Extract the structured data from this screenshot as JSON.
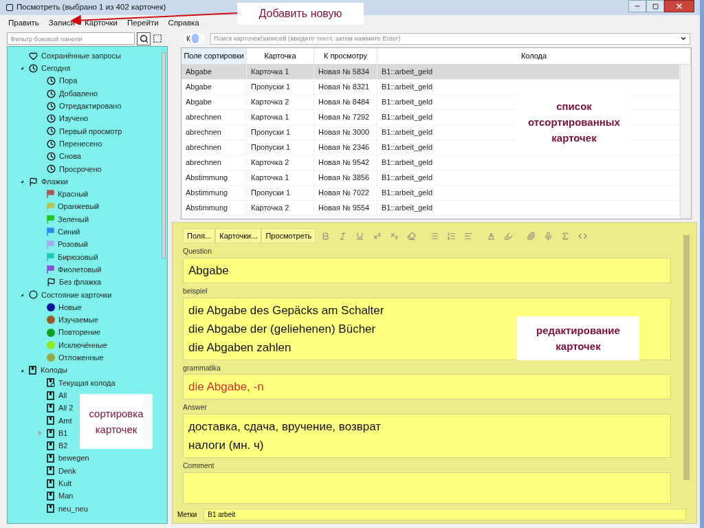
{
  "window": {
    "title": "Посмотреть (выбрано 1 из 402 карточек)"
  },
  "menu": [
    "Править",
    "Записи",
    "Карточки",
    "Перейти",
    "Справка"
  ],
  "sidebar": {
    "filter_placeholder": "Фильтр боковой панели",
    "items": [
      {
        "kind": "saved",
        "label": "Сохранённые запросы"
      },
      {
        "kind": "clock",
        "label": "Сегодня",
        "expanded": true,
        "children": [
          {
            "kind": "clock",
            "label": "Пора"
          },
          {
            "kind": "clock",
            "label": "Добавлено"
          },
          {
            "kind": "clock",
            "label": "Отредактировано"
          },
          {
            "kind": "clock",
            "label": "Изучено"
          },
          {
            "kind": "clock",
            "label": "Первый просмотр"
          },
          {
            "kind": "clock",
            "label": "Перенесено"
          },
          {
            "kind": "clock",
            "label": "Снова"
          },
          {
            "kind": "clock",
            "label": "Просрочено"
          }
        ]
      },
      {
        "kind": "flag",
        "label": "Флажки",
        "expanded": true,
        "children": [
          {
            "kind": "flag",
            "label": "Красный",
            "color": "#b0535a"
          },
          {
            "kind": "flag",
            "label": "Оранжевый",
            "color": "#b8c050"
          },
          {
            "kind": "flag",
            "label": "Зеленый",
            "color": "#1ec81e"
          },
          {
            "kind": "flag",
            "label": "Синий",
            "color": "#2a8ee8"
          },
          {
            "kind": "flag",
            "label": "Розовый",
            "color": "#a6a6ee"
          },
          {
            "kind": "flag",
            "label": "Бирюзовый",
            "color": "#20c8b4"
          },
          {
            "kind": "flag",
            "label": "Фиолетовый",
            "color": "#8a50e0"
          },
          {
            "kind": "flag",
            "label": "Без флажка"
          }
        ]
      },
      {
        "kind": "state",
        "label": "Состояние карточки",
        "expanded": true,
        "children": [
          {
            "kind": "dot",
            "label": "Новые",
            "color": "#0a14a0"
          },
          {
            "kind": "dot",
            "label": "Изучаемые",
            "color": "#9a5a28"
          },
          {
            "kind": "dot",
            "label": "Повторение",
            "color": "#10a020"
          },
          {
            "kind": "dot",
            "label": "Исключённые",
            "color": "#8ee81c"
          },
          {
            "kind": "dot",
            "label": "Отложенные",
            "color": "#9aa840"
          }
        ]
      },
      {
        "kind": "deck",
        "label": "Колоды",
        "expanded": true,
        "children": [
          {
            "kind": "current",
            "label": "Текущая колода"
          },
          {
            "kind": "deck",
            "label": "All"
          },
          {
            "kind": "deck",
            "label": "All 2"
          },
          {
            "kind": "deck",
            "label": "Amt"
          },
          {
            "kind": "deck",
            "label": "B1",
            "expanded": false
          },
          {
            "kind": "deck",
            "label": "B2"
          },
          {
            "kind": "deck",
            "label": "bewegen"
          },
          {
            "kind": "deck",
            "label": "Denk"
          },
          {
            "kind": "deck",
            "label": "Kult"
          },
          {
            "kind": "deck",
            "label": "Man"
          },
          {
            "kind": "deck",
            "label": "neu_neu"
          }
        ]
      }
    ]
  },
  "toggle": {
    "label": "К",
    "on": false
  },
  "search": {
    "placeholder": "Поиск карточек/записей (введите текст, затем нажмите Enter)"
  },
  "table": {
    "columns": [
      "Поле сортировки",
      "Карточка",
      "К просмотру",
      "Колода"
    ],
    "rows": [
      {
        "cells": [
          "Abgabe",
          "Карточка 1",
          "Новая № 5834",
          "B1::arbeit_geld"
        ],
        "selected": true
      },
      {
        "cells": [
          "Abgabe",
          "Пропуски 1",
          "Новая № 8321",
          "B1::arbeit_geld"
        ],
        "selected": false
      },
      {
        "cells": [
          "Abgabe",
          "Карточка 2",
          "Новая № 8484",
          "B1::arbeit_geld"
        ],
        "selected": false
      },
      {
        "cells": [
          "abrechnen",
          "Карточка 1",
          "Новая № 7292",
          "B1::arbeit_geld"
        ],
        "selected": false
      },
      {
        "cells": [
          "abrechnen",
          "Пропуски 1",
          "Новая № 3000",
          "B1::arbeit_geld"
        ],
        "selected": false
      },
      {
        "cells": [
          "abrechnen",
          "Пропуски 1",
          "Новая № 2346",
          "B1::arbeit_geld"
        ],
        "selected": false
      },
      {
        "cells": [
          "abrechnen",
          "Карточка 2",
          "Новая № 9542",
          "B1::arbeit_geld"
        ],
        "selected": false
      },
      {
        "cells": [
          "Abstimmung",
          "Карточка 1",
          "Новая № 3856",
          "B1::arbeit_geld"
        ],
        "selected": false
      },
      {
        "cells": [
          "Abstimmung",
          "Пропуски 1",
          "Новая № 7022",
          "B1::arbeit_geld"
        ],
        "selected": false
      },
      {
        "cells": [
          "Abstimmung",
          "Карточка 2",
          "Новая № 9554",
          "B1::arbeit_geld"
        ],
        "selected": false
      }
    ]
  },
  "editor": {
    "buttons": [
      "Поля...",
      "Карточки...",
      "Просмотреть"
    ],
    "fields": [
      {
        "name": "Question",
        "lines": [
          "Abgabe"
        ]
      },
      {
        "name": "beispiel",
        "lines": [
          "die Abgabe des Gepäcks am Schalter",
          "die Abgabe der (geliehenen) Bücher",
          "die Abgaben zahlen"
        ]
      },
      {
        "name": "grammatika",
        "lines": [
          "die Abgabe, -n"
        ],
        "color": "#d83030"
      },
      {
        "name": "Answer",
        "lines": [
          "доставка, сдача, вручение, возврат",
          "налоги (мн. ч)"
        ]
      },
      {
        "name": "Comment"
      }
    ],
    "tags_label": "Метки",
    "tags": "B1 arbeit"
  },
  "annotations": [
    "Добавить новую",
    "список отсортированных карточек",
    "редактирование карточек",
    "сортировка карточек"
  ]
}
